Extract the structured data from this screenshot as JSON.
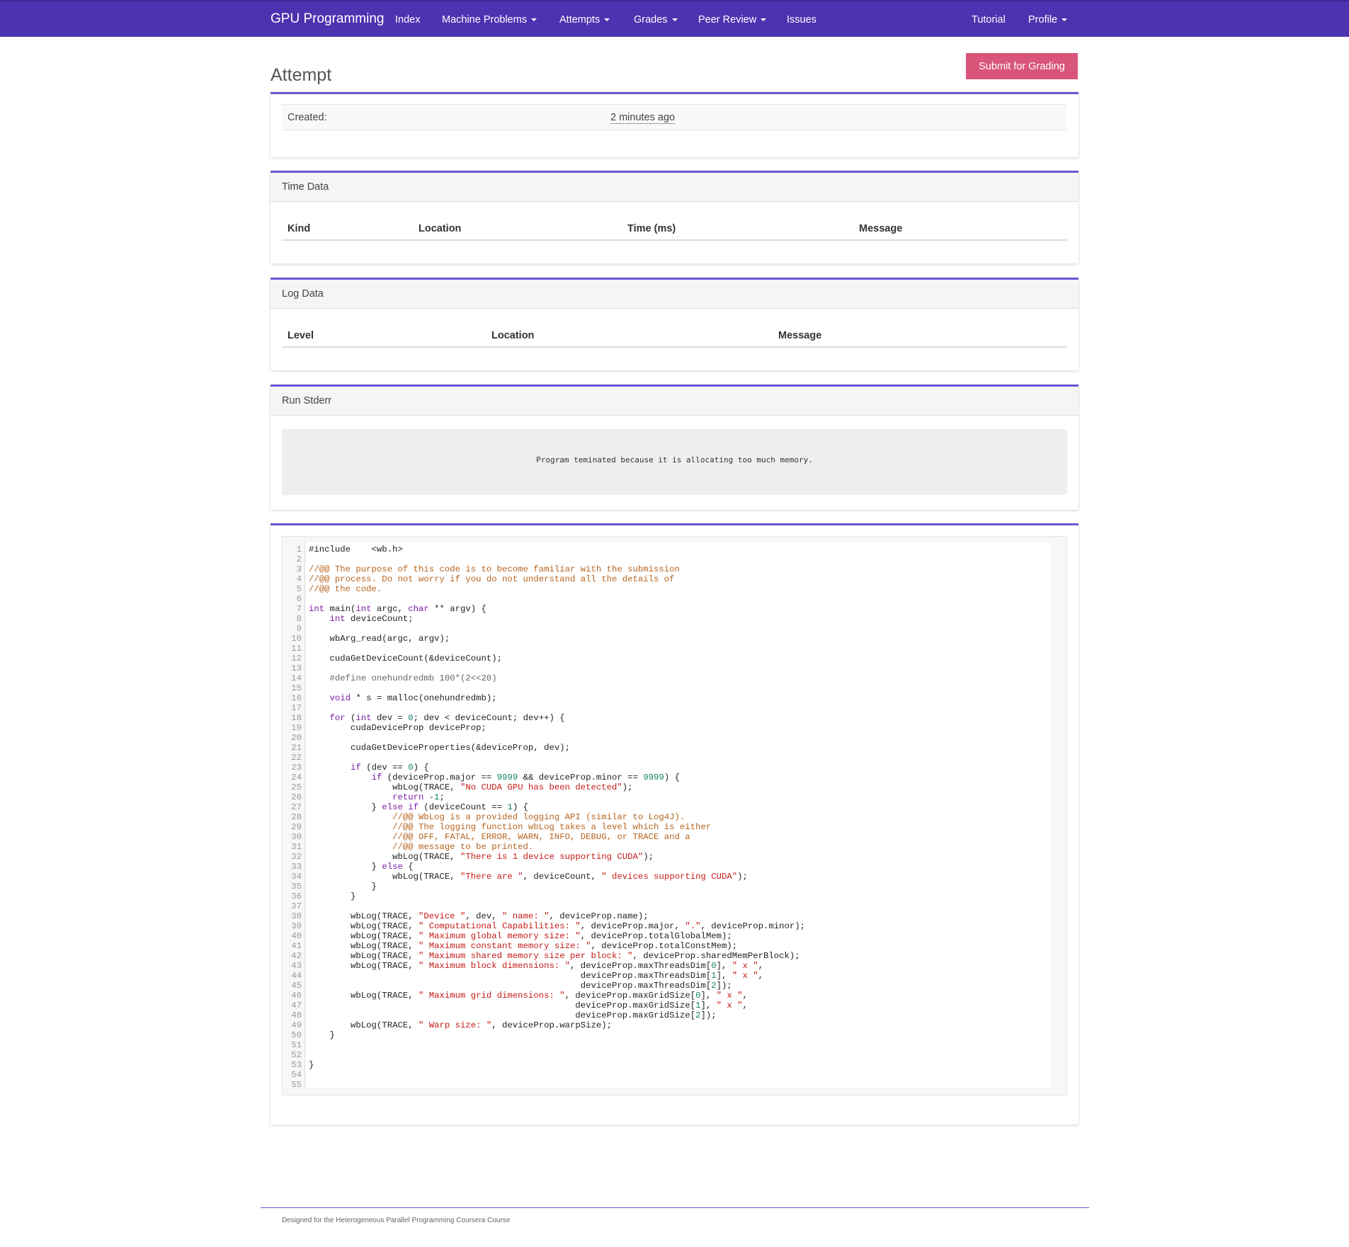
{
  "navbar": {
    "brand": "GPU Programming",
    "items": [
      {
        "label": "Index"
      },
      {
        "label": "Machine Problems"
      },
      {
        "label": "Attempts"
      },
      {
        "label": "Grades"
      },
      {
        "label": "Peer Review"
      },
      {
        "label": "Issues"
      }
    ],
    "right_items": [
      {
        "label": "Tutorial"
      },
      {
        "label": "Profile"
      }
    ]
  },
  "page": {
    "title": "Attempt",
    "submit_label": "Submit for Grading"
  },
  "summary": {
    "created_label": "Created:",
    "created_value": "2 minutes ago"
  },
  "time_data": {
    "heading": "Time Data",
    "columns": [
      "Kind",
      "Location",
      "Time (ms)",
      "Message"
    ]
  },
  "log_data": {
    "heading": "Log Data",
    "columns": [
      "Level",
      "Location",
      "Message"
    ]
  },
  "run_stderr": {
    "heading": "Run Stderr",
    "text": "Program teminated because it is allocating too much memory."
  },
  "code": {
    "line_count": 55,
    "lines": [
      "#include    <wb.h>",
      "",
      "//@@ The purpose of this code is to become familiar with the submission",
      "//@@ process. Do not worry if you do not understand all the details of",
      "//@@ the code.",
      "",
      "int main(int argc, char ** argv) {",
      "    int deviceCount;",
      "",
      "    wbArg_read(argc, argv);",
      "",
      "    cudaGetDeviceCount(&deviceCount);",
      "",
      "    #define onehundredmb 100*(2<<20)",
      "",
      "    void * s = malloc(onehundredmb);",
      "",
      "    for (int dev = 0; dev < deviceCount; dev++) {",
      "        cudaDeviceProp deviceProp;",
      "",
      "        cudaGetDeviceProperties(&deviceProp, dev);",
      "",
      "        if (dev == 0) {",
      "            if (deviceProp.major == 9999 && deviceProp.minor == 9999) {",
      "                wbLog(TRACE, \"No CUDA GPU has been detected\");",
      "                return -1;",
      "            } else if (deviceCount == 1) {",
      "                //@@ WbLog is a provided logging API (similar to Log4J).",
      "                //@@ The logging function wbLog takes a level which is either",
      "                //@@ OFF, FATAL, ERROR, WARN, INFO, DEBUG, or TRACE and a",
      "                //@@ message to be printed.",
      "                wbLog(TRACE, \"There is 1 device supporting CUDA\");",
      "            } else {",
      "                wbLog(TRACE, \"There are \", deviceCount, \" devices supporting CUDA\");",
      "            }",
      "        }",
      "",
      "        wbLog(TRACE, \"Device \", dev, \" name: \", deviceProp.name);",
      "        wbLog(TRACE, \" Computational Capabilities: \", deviceProp.major, \".\", deviceProp.minor);",
      "        wbLog(TRACE, \" Maximum global memory size: \", deviceProp.totalGlobalMem);",
      "        wbLog(TRACE, \" Maximum constant memory size: \", deviceProp.totalConstMem);",
      "        wbLog(TRACE, \" Maximum shared memory size per block: \", deviceProp.sharedMemPerBlock);",
      "        wbLog(TRACE, \" Maximum block dimensions: \", deviceProp.maxThreadsDim[0], \" x \",",
      "                                                    deviceProp.maxThreadsDim[1], \" x \",",
      "                                                    deviceProp.maxThreadsDim[2]);",
      "        wbLog(TRACE, \" Maximum grid dimensions: \", deviceProp.maxGridSize[0], \" x \",",
      "                                                   deviceProp.maxGridSize[1], \" x \",",
      "                                                   deviceProp.maxGridSize[2]);",
      "        wbLog(TRACE, \" Warp size: \", deviceProp.warpSize);",
      "    }",
      "",
      "",
      "}",
      "",
      ""
    ]
  },
  "footer": {
    "text": "Designed for the Heterogeneous Parallel Programming Coursera Course"
  },
  "colors": {
    "navbar": "#4c33b0",
    "accent_border": "#6a55d6",
    "submit_button": "#d9557a"
  }
}
